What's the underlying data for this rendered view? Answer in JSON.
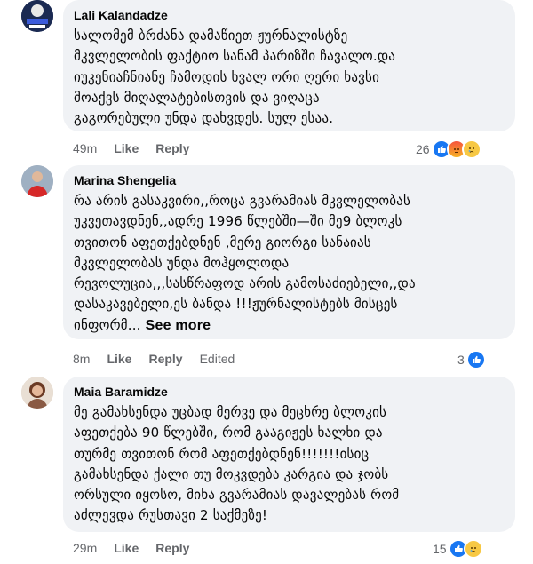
{
  "comments": [
    {
      "author": "Lali Kalandadze",
      "text": "სალომემ ბრძანა დამაწიეთ ჟურნალისტზე\nმკვლელობის ფაქტიო სანამ პარიზში ჩავალო.და\nიუკენიაჩნიანე ჩამოდის ხვალ ორი ღერი ხავსი\nმოაქვს მიღალატებისთვის და ვიღაცა\nგაგორებული უნდა დახვდეს. სულ ესაა.",
      "time": "49m",
      "like": "Like",
      "reply": "Reply",
      "reaction_count": "26",
      "avatar_color": "#2c3e66"
    },
    {
      "author": "Marina Shengelia",
      "text": "რა არის გასაკვირი,,როცა გვარამიას მკვლელობას\nუკვეთავდნენ,,ადრე 1996 წლებში—ში მე9 ბლოკს\nთვითონ აფეთქებდნენ ,მერე გიორგი სანაიას\nმკვლელობას უნდა მოჰყოლოდა\nრევოლუცია,,,სასწრაფოდ არის გამოსაძიებელი,,და\nდასაკავებელი,ეს ბანდა !!!ჟურნალისტებს მისცეს\nინფორმ...",
      "see_more": "See more",
      "time": "8m",
      "like": "Like",
      "reply": "Reply",
      "edited": "Edited",
      "reaction_count": "3",
      "avatar_color": "#d93025"
    },
    {
      "author": "Maia Baramidze",
      "text": "მე გამახსენდა უცბად მერვე და მეცხრე ბლოკის\nაფეთქება 90 წლებში, რომ გააგიჟეს ხალხი და\nთურმე თვითონ რომ აფეთქებდნენ!!!!!!!ისიც\nგამახსენდა ქალი თუ მოკვდება კარგია და ჯობს\nორსული იყოსო, მიხა გვარამიას დავალებას რომ\nაძლევდა რუსთავი 2 საქმეზე!",
      "time": "29m",
      "like": "Like",
      "reply": "Reply",
      "reaction_count": "15",
      "avatar_color": "#a0522d"
    }
  ]
}
